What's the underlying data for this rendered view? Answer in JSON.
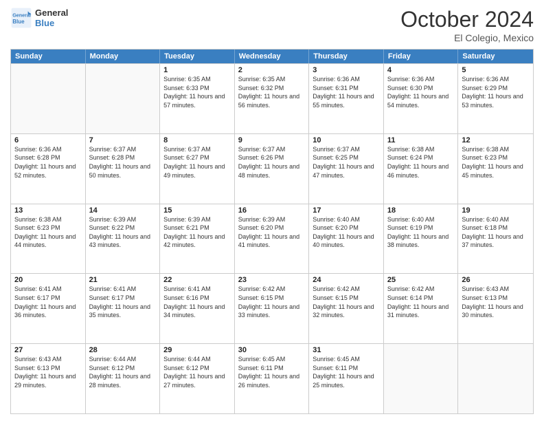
{
  "logo": {
    "line1": "General",
    "line2": "Blue"
  },
  "title": {
    "month": "October 2024",
    "location": "El Colegio, Mexico"
  },
  "weekdays": [
    "Sunday",
    "Monday",
    "Tuesday",
    "Wednesday",
    "Thursday",
    "Friday",
    "Saturday"
  ],
  "weeks": [
    [
      {
        "day": "",
        "empty": true
      },
      {
        "day": "",
        "empty": true
      },
      {
        "day": "1",
        "sunrise": "Sunrise: 6:35 AM",
        "sunset": "Sunset: 6:33 PM",
        "daylight": "Daylight: 11 hours and 57 minutes."
      },
      {
        "day": "2",
        "sunrise": "Sunrise: 6:35 AM",
        "sunset": "Sunset: 6:32 PM",
        "daylight": "Daylight: 11 hours and 56 minutes."
      },
      {
        "day": "3",
        "sunrise": "Sunrise: 6:36 AM",
        "sunset": "Sunset: 6:31 PM",
        "daylight": "Daylight: 11 hours and 55 minutes."
      },
      {
        "day": "4",
        "sunrise": "Sunrise: 6:36 AM",
        "sunset": "Sunset: 6:30 PM",
        "daylight": "Daylight: 11 hours and 54 minutes."
      },
      {
        "day": "5",
        "sunrise": "Sunrise: 6:36 AM",
        "sunset": "Sunset: 6:29 PM",
        "daylight": "Daylight: 11 hours and 53 minutes."
      }
    ],
    [
      {
        "day": "6",
        "sunrise": "Sunrise: 6:36 AM",
        "sunset": "Sunset: 6:28 PM",
        "daylight": "Daylight: 11 hours and 52 minutes."
      },
      {
        "day": "7",
        "sunrise": "Sunrise: 6:37 AM",
        "sunset": "Sunset: 6:28 PM",
        "daylight": "Daylight: 11 hours and 50 minutes."
      },
      {
        "day": "8",
        "sunrise": "Sunrise: 6:37 AM",
        "sunset": "Sunset: 6:27 PM",
        "daylight": "Daylight: 11 hours and 49 minutes."
      },
      {
        "day": "9",
        "sunrise": "Sunrise: 6:37 AM",
        "sunset": "Sunset: 6:26 PM",
        "daylight": "Daylight: 11 hours and 48 minutes."
      },
      {
        "day": "10",
        "sunrise": "Sunrise: 6:37 AM",
        "sunset": "Sunset: 6:25 PM",
        "daylight": "Daylight: 11 hours and 47 minutes."
      },
      {
        "day": "11",
        "sunrise": "Sunrise: 6:38 AM",
        "sunset": "Sunset: 6:24 PM",
        "daylight": "Daylight: 11 hours and 46 minutes."
      },
      {
        "day": "12",
        "sunrise": "Sunrise: 6:38 AM",
        "sunset": "Sunset: 6:23 PM",
        "daylight": "Daylight: 11 hours and 45 minutes."
      }
    ],
    [
      {
        "day": "13",
        "sunrise": "Sunrise: 6:38 AM",
        "sunset": "Sunset: 6:23 PM",
        "daylight": "Daylight: 11 hours and 44 minutes."
      },
      {
        "day": "14",
        "sunrise": "Sunrise: 6:39 AM",
        "sunset": "Sunset: 6:22 PM",
        "daylight": "Daylight: 11 hours and 43 minutes."
      },
      {
        "day": "15",
        "sunrise": "Sunrise: 6:39 AM",
        "sunset": "Sunset: 6:21 PM",
        "daylight": "Daylight: 11 hours and 42 minutes."
      },
      {
        "day": "16",
        "sunrise": "Sunrise: 6:39 AM",
        "sunset": "Sunset: 6:20 PM",
        "daylight": "Daylight: 11 hours and 41 minutes."
      },
      {
        "day": "17",
        "sunrise": "Sunrise: 6:40 AM",
        "sunset": "Sunset: 6:20 PM",
        "daylight": "Daylight: 11 hours and 40 minutes."
      },
      {
        "day": "18",
        "sunrise": "Sunrise: 6:40 AM",
        "sunset": "Sunset: 6:19 PM",
        "daylight": "Daylight: 11 hours and 38 minutes."
      },
      {
        "day": "19",
        "sunrise": "Sunrise: 6:40 AM",
        "sunset": "Sunset: 6:18 PM",
        "daylight": "Daylight: 11 hours and 37 minutes."
      }
    ],
    [
      {
        "day": "20",
        "sunrise": "Sunrise: 6:41 AM",
        "sunset": "Sunset: 6:17 PM",
        "daylight": "Daylight: 11 hours and 36 minutes."
      },
      {
        "day": "21",
        "sunrise": "Sunrise: 6:41 AM",
        "sunset": "Sunset: 6:17 PM",
        "daylight": "Daylight: 11 hours and 35 minutes."
      },
      {
        "day": "22",
        "sunrise": "Sunrise: 6:41 AM",
        "sunset": "Sunset: 6:16 PM",
        "daylight": "Daylight: 11 hours and 34 minutes."
      },
      {
        "day": "23",
        "sunrise": "Sunrise: 6:42 AM",
        "sunset": "Sunset: 6:15 PM",
        "daylight": "Daylight: 11 hours and 33 minutes."
      },
      {
        "day": "24",
        "sunrise": "Sunrise: 6:42 AM",
        "sunset": "Sunset: 6:15 PM",
        "daylight": "Daylight: 11 hours and 32 minutes."
      },
      {
        "day": "25",
        "sunrise": "Sunrise: 6:42 AM",
        "sunset": "Sunset: 6:14 PM",
        "daylight": "Daylight: 11 hours and 31 minutes."
      },
      {
        "day": "26",
        "sunrise": "Sunrise: 6:43 AM",
        "sunset": "Sunset: 6:13 PM",
        "daylight": "Daylight: 11 hours and 30 minutes."
      }
    ],
    [
      {
        "day": "27",
        "sunrise": "Sunrise: 6:43 AM",
        "sunset": "Sunset: 6:13 PM",
        "daylight": "Daylight: 11 hours and 29 minutes."
      },
      {
        "day": "28",
        "sunrise": "Sunrise: 6:44 AM",
        "sunset": "Sunset: 6:12 PM",
        "daylight": "Daylight: 11 hours and 28 minutes."
      },
      {
        "day": "29",
        "sunrise": "Sunrise: 6:44 AM",
        "sunset": "Sunset: 6:12 PM",
        "daylight": "Daylight: 11 hours and 27 minutes."
      },
      {
        "day": "30",
        "sunrise": "Sunrise: 6:45 AM",
        "sunset": "Sunset: 6:11 PM",
        "daylight": "Daylight: 11 hours and 26 minutes."
      },
      {
        "day": "31",
        "sunrise": "Sunrise: 6:45 AM",
        "sunset": "Sunset: 6:11 PM",
        "daylight": "Daylight: 11 hours and 25 minutes."
      },
      {
        "day": "",
        "empty": true
      },
      {
        "day": "",
        "empty": true
      }
    ]
  ]
}
